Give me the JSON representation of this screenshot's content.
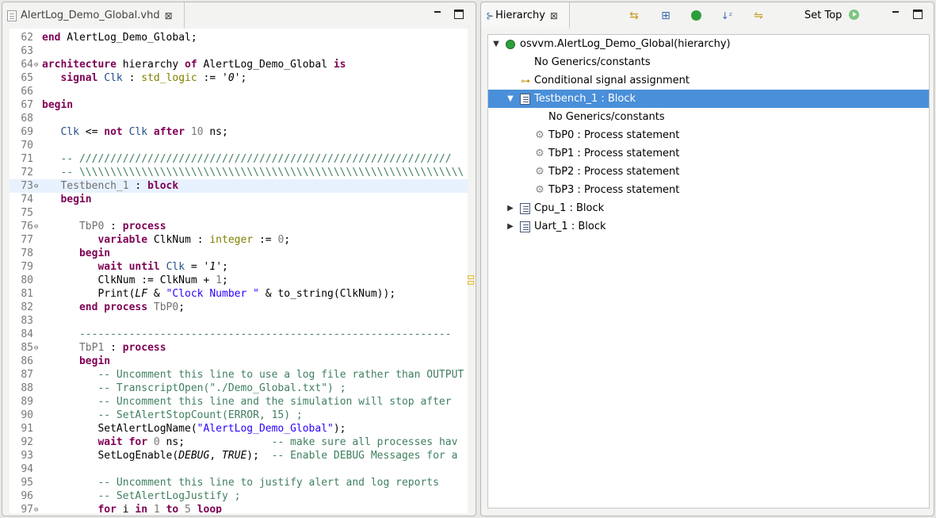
{
  "editor": {
    "tab_title": "AlertLog_Demo_Global.vhd",
    "lines": [
      {
        "n": "62",
        "fold": "",
        "tokens": [
          {
            "c": "kw",
            "t": "end"
          },
          {
            "c": "",
            "t": " AlertLog_Demo_Global;"
          }
        ]
      },
      {
        "n": "63",
        "fold": "",
        "tokens": []
      },
      {
        "n": "64",
        "fold": "⊖",
        "tokens": [
          {
            "c": "kw",
            "t": "architecture"
          },
          {
            "c": "",
            "t": " hierarchy "
          },
          {
            "c": "kw",
            "t": "of"
          },
          {
            "c": "",
            "t": " AlertLog_Demo_Global "
          },
          {
            "c": "kw",
            "t": "is"
          }
        ]
      },
      {
        "n": "65",
        "fold": "",
        "tokens": [
          {
            "c": "",
            "t": "   "
          },
          {
            "c": "kw",
            "t": "signal"
          },
          {
            "c": "",
            "t": " "
          },
          {
            "c": "id",
            "t": "Clk"
          },
          {
            "c": "",
            "t": " : "
          },
          {
            "c": "ty",
            "t": "std_logic"
          },
          {
            "c": "",
            "t": " := '"
          },
          {
            "c": "it",
            "t": "0"
          },
          {
            "c": "",
            "t": "';"
          }
        ]
      },
      {
        "n": "66",
        "fold": "",
        "tokens": []
      },
      {
        "n": "67",
        "fold": "",
        "tokens": [
          {
            "c": "kw",
            "t": "begin"
          }
        ]
      },
      {
        "n": "68",
        "fold": "",
        "tokens": []
      },
      {
        "n": "69",
        "fold": "",
        "tokens": [
          {
            "c": "",
            "t": "   "
          },
          {
            "c": "id",
            "t": "Clk"
          },
          {
            "c": "",
            "t": " <= "
          },
          {
            "c": "kw",
            "t": "not"
          },
          {
            "c": "",
            "t": " "
          },
          {
            "c": "id",
            "t": "Clk"
          },
          {
            "c": "",
            "t": " "
          },
          {
            "c": "kw",
            "t": "after"
          },
          {
            "c": "",
            "t": " "
          },
          {
            "c": "num",
            "t": "10"
          },
          {
            "c": "",
            "t": " ns;"
          }
        ]
      },
      {
        "n": "70",
        "fold": "",
        "tokens": []
      },
      {
        "n": "71",
        "fold": "",
        "tokens": [
          {
            "c": "",
            "t": "   "
          },
          {
            "c": "cm",
            "t": "-- ////////////////////////////////////////////////////////////"
          }
        ]
      },
      {
        "n": "72",
        "fold": "",
        "tokens": [
          {
            "c": "",
            "t": "   "
          },
          {
            "c": "cm",
            "t": "-- \\\\\\\\\\\\\\\\\\\\\\\\\\\\\\\\\\\\\\\\\\\\\\\\\\\\\\\\\\\\\\\\\\\\\\\\\\\\\\\\\\\\\\\\\\\\\\\\\\\\\\\\\\\\\\\\\\\\\\\\\\\\"
          }
        ]
      },
      {
        "n": "73",
        "fold": "⊖",
        "current": true,
        "tokens": [
          {
            "c": "",
            "t": "   "
          },
          {
            "c": "lbl",
            "t": "Testbench_1"
          },
          {
            "c": "",
            "t": " : "
          },
          {
            "c": "kw",
            "t": "block"
          }
        ]
      },
      {
        "n": "74",
        "fold": "",
        "tokens": [
          {
            "c": "",
            "t": "   "
          },
          {
            "c": "kw",
            "t": "begin"
          }
        ]
      },
      {
        "n": "75",
        "fold": "",
        "tokens": []
      },
      {
        "n": "76",
        "fold": "⊖",
        "tokens": [
          {
            "c": "",
            "t": "      "
          },
          {
            "c": "lbl",
            "t": "TbP0"
          },
          {
            "c": "",
            "t": " : "
          },
          {
            "c": "kw",
            "t": "process"
          }
        ]
      },
      {
        "n": "77",
        "fold": "",
        "tokens": [
          {
            "c": "",
            "t": "         "
          },
          {
            "c": "kw",
            "t": "variable"
          },
          {
            "c": "",
            "t": " ClkNum : "
          },
          {
            "c": "ty",
            "t": "integer"
          },
          {
            "c": "",
            "t": " := "
          },
          {
            "c": "num",
            "t": "0"
          },
          {
            "c": "",
            "t": ";"
          }
        ]
      },
      {
        "n": "78",
        "fold": "",
        "tokens": [
          {
            "c": "",
            "t": "      "
          },
          {
            "c": "kw",
            "t": "begin"
          }
        ]
      },
      {
        "n": "79",
        "fold": "",
        "tokens": [
          {
            "c": "",
            "t": "         "
          },
          {
            "c": "kw",
            "t": "wait until"
          },
          {
            "c": "",
            "t": " "
          },
          {
            "c": "id",
            "t": "Clk"
          },
          {
            "c": "",
            "t": " = '"
          },
          {
            "c": "it",
            "t": "1"
          },
          {
            "c": "",
            "t": "';"
          }
        ]
      },
      {
        "n": "80",
        "fold": "",
        "tokens": [
          {
            "c": "",
            "t": "         ClkNum := ClkNum + "
          },
          {
            "c": "num",
            "t": "1"
          },
          {
            "c": "",
            "t": ";"
          }
        ]
      },
      {
        "n": "81",
        "fold": "",
        "tokens": [
          {
            "c": "",
            "t": "         Print("
          },
          {
            "c": "it",
            "t": "LF"
          },
          {
            "c": "",
            "t": " & "
          },
          {
            "c": "str",
            "t": "\"Clock Number \""
          },
          {
            "c": "",
            "t": " & to_string(ClkNum));"
          }
        ]
      },
      {
        "n": "82",
        "fold": "",
        "tokens": [
          {
            "c": "",
            "t": "      "
          },
          {
            "c": "kw",
            "t": "end process"
          },
          {
            "c": "",
            "t": " "
          },
          {
            "c": "lbl",
            "t": "TbP0"
          },
          {
            "c": "",
            "t": ";"
          }
        ]
      },
      {
        "n": "83",
        "fold": "",
        "tokens": []
      },
      {
        "n": "84",
        "fold": "",
        "tokens": [
          {
            "c": "",
            "t": "      "
          },
          {
            "c": "cm",
            "t": "------------------------------------------------------------"
          }
        ]
      },
      {
        "n": "85",
        "fold": "⊖",
        "tokens": [
          {
            "c": "",
            "t": "      "
          },
          {
            "c": "lbl",
            "t": "TbP1"
          },
          {
            "c": "",
            "t": " : "
          },
          {
            "c": "kw",
            "t": "process"
          }
        ]
      },
      {
        "n": "86",
        "fold": "",
        "tokens": [
          {
            "c": "",
            "t": "      "
          },
          {
            "c": "kw",
            "t": "begin"
          }
        ]
      },
      {
        "n": "87",
        "fold": "",
        "tokens": [
          {
            "c": "",
            "t": "         "
          },
          {
            "c": "cm",
            "t": "-- Uncomment this line to use a log file rather than OUTPUT"
          }
        ]
      },
      {
        "n": "88",
        "fold": "",
        "tokens": [
          {
            "c": "",
            "t": "         "
          },
          {
            "c": "cm",
            "t": "-- TranscriptOpen(\"./Demo_Global.txt\") ;"
          }
        ]
      },
      {
        "n": "89",
        "fold": "",
        "tokens": [
          {
            "c": "",
            "t": "         "
          },
          {
            "c": "cm",
            "t": "-- Uncomment this line and the simulation will stop after"
          }
        ]
      },
      {
        "n": "90",
        "fold": "",
        "tokens": [
          {
            "c": "",
            "t": "         "
          },
          {
            "c": "cm",
            "t": "-- SetAlertStopCount(ERROR, 15) ;"
          }
        ]
      },
      {
        "n": "91",
        "fold": "",
        "tokens": [
          {
            "c": "",
            "t": "         SetAlertLogName("
          },
          {
            "c": "str",
            "t": "\"AlertLog_Demo_Global\""
          },
          {
            "c": "",
            "t": ");"
          }
        ]
      },
      {
        "n": "92",
        "fold": "",
        "tokens": [
          {
            "c": "",
            "t": "         "
          },
          {
            "c": "kw",
            "t": "wait for"
          },
          {
            "c": "",
            "t": " "
          },
          {
            "c": "num",
            "t": "0"
          },
          {
            "c": "",
            "t": " ns;              "
          },
          {
            "c": "cm",
            "t": "-- make sure all processes hav"
          }
        ]
      },
      {
        "n": "93",
        "fold": "",
        "tokens": [
          {
            "c": "",
            "t": "         SetLogEnable("
          },
          {
            "c": "it",
            "t": "DEBUG"
          },
          {
            "c": "",
            "t": ", "
          },
          {
            "c": "it",
            "t": "TRUE"
          },
          {
            "c": "",
            "t": ");  "
          },
          {
            "c": "cm",
            "t": "-- Enable DEBUG Messages for a"
          }
        ]
      },
      {
        "n": "94",
        "fold": "",
        "tokens": []
      },
      {
        "n": "95",
        "fold": "",
        "tokens": [
          {
            "c": "",
            "t": "         "
          },
          {
            "c": "cm",
            "t": "-- Uncomment this line to justify alert and log reports"
          }
        ]
      },
      {
        "n": "96",
        "fold": "",
        "tokens": [
          {
            "c": "",
            "t": "         "
          },
          {
            "c": "cm",
            "t": "-- SetAlertLogJustify ;"
          }
        ]
      },
      {
        "n": "97",
        "fold": "⊖",
        "tokens": [
          {
            "c": "",
            "t": "         "
          },
          {
            "c": "kw",
            "t": "for"
          },
          {
            "c": "",
            "t": " i "
          },
          {
            "c": "kw",
            "t": "in"
          },
          {
            "c": "",
            "t": " "
          },
          {
            "c": "num",
            "t": "1"
          },
          {
            "c": "",
            "t": " "
          },
          {
            "c": "kw",
            "t": "to"
          },
          {
            "c": "",
            "t": " "
          },
          {
            "c": "num",
            "t": "5"
          },
          {
            "c": "",
            "t": " "
          },
          {
            "c": "kw",
            "t": "loop"
          }
        ]
      }
    ]
  },
  "hierarchy": {
    "tab_title": "Hierarchy",
    "set_top_label": "Set Top",
    "toolbar_icons": [
      "sync-icon",
      "expand-icon",
      "info-icon",
      "sort-az-icon",
      "link-icon"
    ],
    "rows": [
      {
        "label": "osvvm.AlertLog_Demo_Global(hierarchy)",
        "indent": 0,
        "twisty": "▼",
        "icon": "green-circle"
      },
      {
        "label": "No Generics/constants",
        "indent": 1,
        "twisty": "",
        "icon": ""
      },
      {
        "label": "Conditional signal assignment",
        "indent": 1,
        "twisty": "",
        "icon": "key"
      },
      {
        "label": "Testbench_1 : Block",
        "indent": 1,
        "twisty": "▼",
        "icon": "block",
        "selected": true
      },
      {
        "label": "No Generics/constants",
        "indent": 2,
        "twisty": "",
        "icon": ""
      },
      {
        "label": "TbP0 : Process statement",
        "indent": 2,
        "twisty": "",
        "icon": "gear"
      },
      {
        "label": "TbP1 : Process statement",
        "indent": 2,
        "twisty": "",
        "icon": "gear"
      },
      {
        "label": "TbP2 : Process statement",
        "indent": 2,
        "twisty": "",
        "icon": "gear"
      },
      {
        "label": "TbP3 : Process statement",
        "indent": 2,
        "twisty": "",
        "icon": "gear"
      },
      {
        "label": "Cpu_1 : Block",
        "indent": 1,
        "twisty": "▶",
        "icon": "block"
      },
      {
        "label": "Uart_1 : Block",
        "indent": 1,
        "twisty": "▶",
        "icon": "block"
      }
    ]
  }
}
